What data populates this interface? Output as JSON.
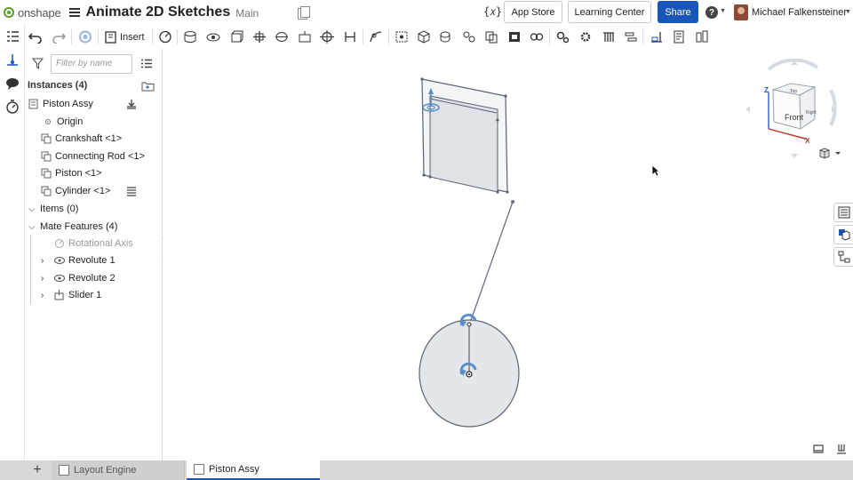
{
  "app": {
    "brand": "onshape",
    "document_title": "Animate 2D Sketches",
    "branch": "Main"
  },
  "header": {
    "variable_icon": "{𝑥}",
    "app_store_label": "App Store",
    "learning_center_label": "Learning Center",
    "share_label": "Share",
    "help_label": "?",
    "user_name": "Michael Falkensteiner",
    "accent_color": "#1a56b8"
  },
  "toolbar": {
    "insert_label": "Insert",
    "icons": [
      "undo-icon",
      "redo-icon",
      "loading-icon",
      "insert-icon",
      "rotational-axis-icon",
      "fastened-mate-icon",
      "revolute-mate-icon",
      "slider-mate-icon",
      "planar-mate-icon",
      "cylindrical-mate-icon",
      "pin-slot-mate-icon",
      "ball-mate-icon",
      "parallel-mate-icon",
      "tangent-mate-icon",
      "mate-connector-icon",
      "group-icon",
      "replicate-icon",
      "pattern-icon",
      "section-view-icon",
      "explode-icon",
      "measure-icon",
      "gear-relation-icon",
      "rack-pinion-icon",
      "screw-relation-icon",
      "linear-relation-icon",
      "display-state-icon",
      "bom-icon",
      "named-position-icon"
    ]
  },
  "panel": {
    "filter_placeholder": "Filter by name",
    "instances_title": "Instances (4)",
    "instances": [
      {
        "label": "Piston Assy"
      },
      {
        "label": "Origin"
      },
      {
        "label": "Crankshaft <1>"
      },
      {
        "label": "Connecting Rod <1>"
      },
      {
        "label": "Piston <1>"
      },
      {
        "label": "Cylinder <1>"
      }
    ],
    "items_title": "Items (0)",
    "mates_title": "Mate Features (4)",
    "mates": [
      {
        "label": "Rotational Axis",
        "disabled": true
      },
      {
        "label": "Revolute 1"
      },
      {
        "label": "Revolute 2"
      },
      {
        "label": "Slider 1"
      }
    ]
  },
  "viewcube": {
    "front_label": "Front",
    "top_label": "Top",
    "right_label": "Right",
    "z_label": "Z",
    "x_label": "X"
  },
  "tabs": [
    {
      "label": "Layout Engine",
      "active": false
    },
    {
      "label": "Piston Assy",
      "active": true
    }
  ]
}
